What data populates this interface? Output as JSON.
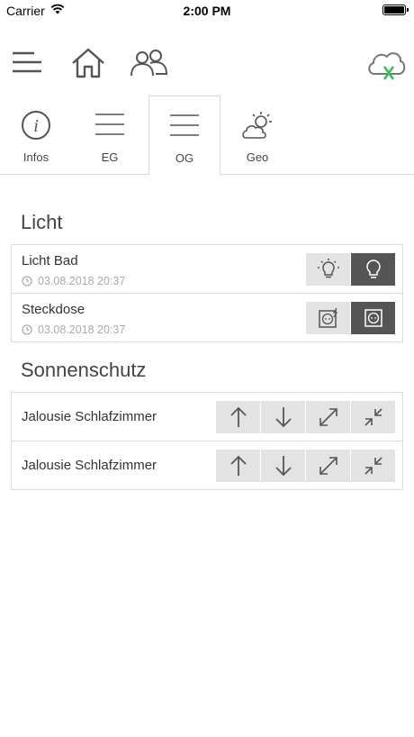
{
  "status_bar": {
    "carrier": "Carrier",
    "time": "2:00 PM"
  },
  "toolbar": {
    "menu_icon": "menu-icon",
    "home_icon": "home-icon",
    "users_icon": "users-icon",
    "cloud_icon": "cloud-disconnected-icon"
  },
  "tabs": [
    {
      "label": "Infos",
      "icon": "info-icon",
      "active": false
    },
    {
      "label": "EG",
      "icon": "floor-icon",
      "active": false
    },
    {
      "label": "OG",
      "icon": "floor-icon",
      "active": true
    },
    {
      "label": "Geo",
      "icon": "weather-icon",
      "active": false
    }
  ],
  "sections": {
    "licht": {
      "title": "Licht",
      "rows": [
        {
          "name": "Licht Bad",
          "time": "03.08.2018 20:37",
          "buttons": [
            "light-on-icon",
            "light-off-icon"
          ]
        },
        {
          "name": "Steckdose",
          "time": "03.08.2018 20:37",
          "buttons": [
            "socket-on-icon",
            "socket-off-icon"
          ]
        }
      ]
    },
    "sonnenschutz": {
      "title": "Sonnenschutz",
      "rows": [
        {
          "name": "Jalousie Schlafzimmer",
          "buttons": [
            "arrow-up-icon",
            "arrow-down-icon",
            "expand-icon",
            "collapse-icon"
          ]
        },
        {
          "name": "Jalousie Schlafzimmer",
          "buttons": [
            "arrow-up-icon",
            "arrow-down-icon",
            "expand-icon",
            "collapse-icon"
          ]
        }
      ]
    }
  },
  "colors": {
    "accent_green": "#3dbb5a",
    "active_button": "#555555",
    "button_bg": "#e3e3e3"
  }
}
